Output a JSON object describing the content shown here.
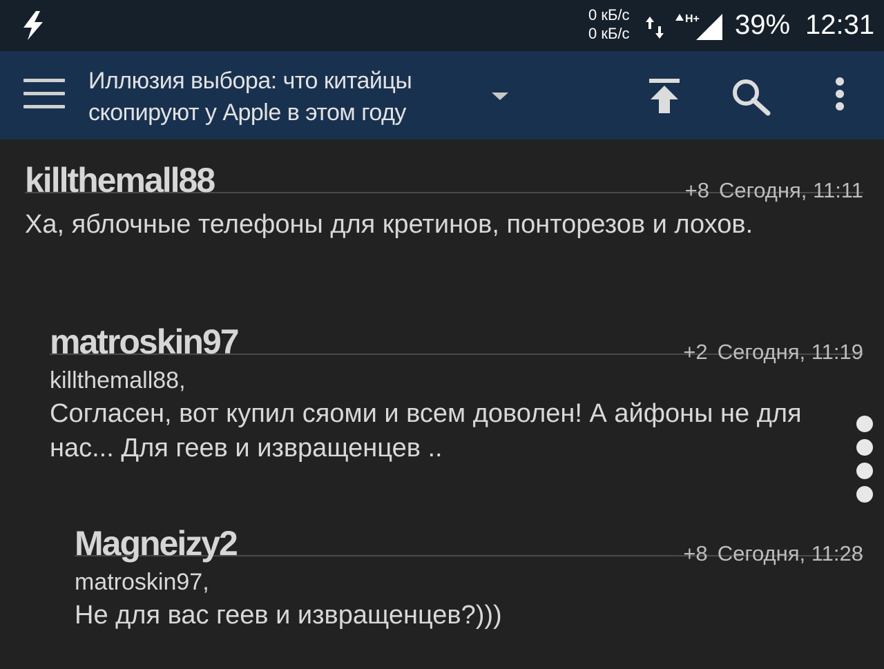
{
  "status_bar": {
    "icon": "lightning-bolt-icon",
    "net_up": "0 кБ/с",
    "net_down": "0 кБ/с",
    "network_type": "H+",
    "battery": "39%",
    "time": "12:31"
  },
  "toolbar": {
    "menu_icon": "hamburger-menu-icon",
    "title_line1": "Иллюзия выбора: что китайцы",
    "title_line2": "скопируют у Apple в этом году",
    "dropdown_icon": "chevron-down-icon",
    "actions": [
      "scroll-to-top-icon",
      "search-icon",
      "more-vertical-icon"
    ]
  },
  "comments": [
    {
      "author": "killthemall88",
      "score": "+8",
      "date": "Сегодня, 11:11",
      "quote": "",
      "text": "Ха, яблочные телефоны для кретинов, понторезов и лохов."
    },
    {
      "author": "matroskin97",
      "score": "+2",
      "date": "Сегодня, 11:19",
      "quote": "killthemall88,",
      "text": "Согласен, вот купил сяоми и всем доволен! А айфоны не для нас... Для геев и извращенцев .."
    },
    {
      "author": "Magneizy2",
      "score": "+8",
      "date": "Сегодня, 11:28",
      "quote": "matroskin97,",
      "text": "Не для вас геев и извращенцев?)))"
    }
  ],
  "colors": {
    "status_bar_bg": "#16202b",
    "toolbar_bg": "#17314f",
    "content_bg": "#222222",
    "text": "#d8d8d8"
  }
}
